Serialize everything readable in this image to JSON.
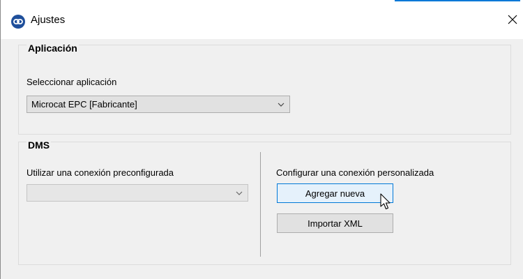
{
  "window": {
    "title": "Ajustes"
  },
  "application": {
    "group_title": "Aplicación",
    "select_label": "Seleccionar aplicación",
    "select_value": "Microcat EPC [Fabricante]"
  },
  "dms": {
    "group_title": "DMS",
    "preconfigured_label": "Utilizar una conexión preconfigurada",
    "preconfigured_value": "",
    "custom_label": "Configurar una conexión personalizada",
    "add_new_button": "Agregar nueva",
    "import_xml_button": "Importar XML"
  },
  "icons": {
    "app": "link-icon",
    "close": "close-icon",
    "dropdown": "chevron-down-icon",
    "cursor": "mouse-pointer-icon"
  },
  "colors": {
    "accent": "#0078d7",
    "button_hover_bg": "#e5f1fb",
    "app_icon_bg": "#1f4f9b"
  }
}
